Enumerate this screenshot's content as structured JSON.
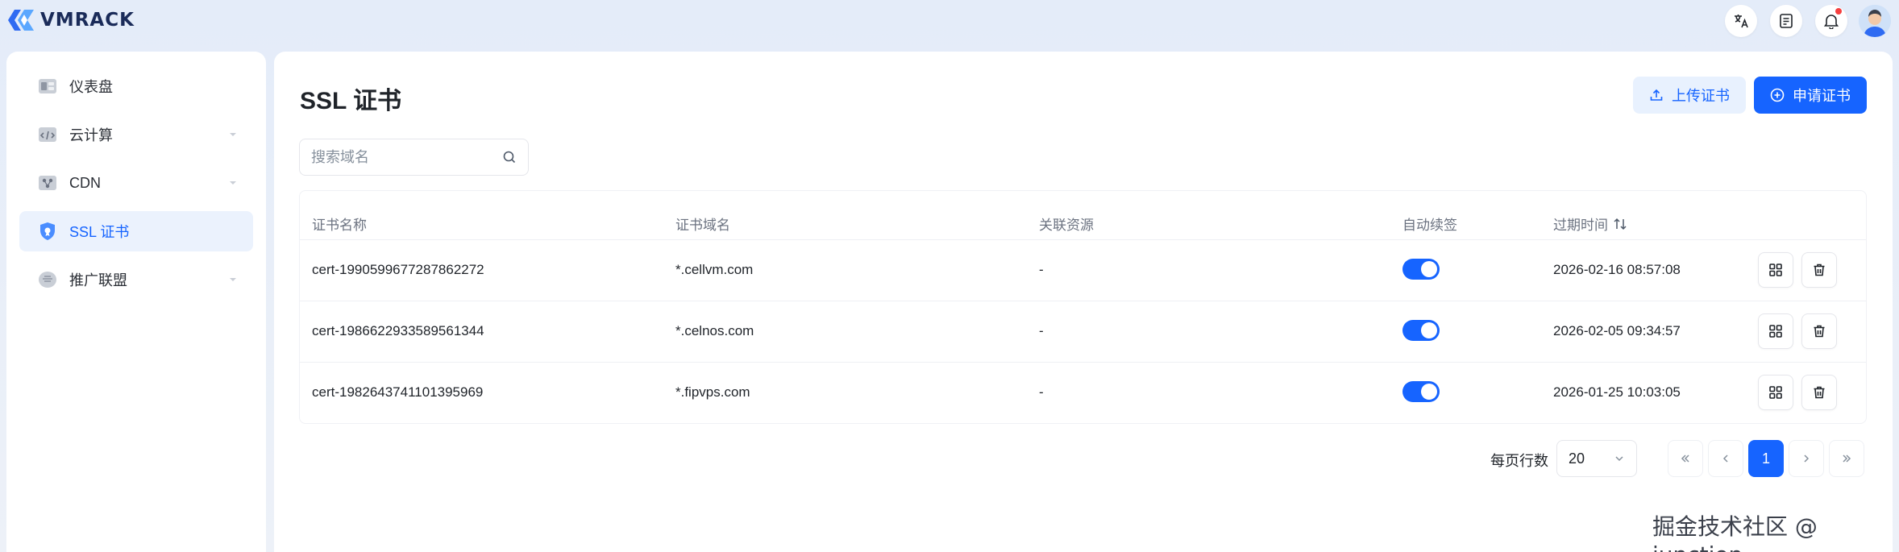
{
  "brand": {
    "name": "VMRACK"
  },
  "header": {
    "icons": [
      "translate-icon",
      "document-icon",
      "bell-icon",
      "avatar"
    ]
  },
  "sidebar": {
    "items": [
      {
        "label": "仪表盘",
        "icon": "dashboard-icon",
        "expandable": false,
        "active": false
      },
      {
        "label": "云计算",
        "icon": "cloud-compute-icon",
        "expandable": true,
        "active": false
      },
      {
        "label": "CDN",
        "icon": "cdn-icon",
        "expandable": true,
        "active": false
      },
      {
        "label": "SSL 证书",
        "icon": "shield-icon",
        "expandable": false,
        "active": true
      },
      {
        "label": "推广联盟",
        "icon": "affiliate-icon",
        "expandable": true,
        "active": false
      }
    ]
  },
  "page": {
    "title": "SSL 证书",
    "upload_label": "上传证书",
    "apply_label": "申请证书",
    "search_placeholder": "搜索域名"
  },
  "table": {
    "columns": [
      "证书名称",
      "证书域名",
      "关联资源",
      "自动续签",
      "过期时间"
    ],
    "rows": [
      {
        "name": "cert-1990599677287862272",
        "domain": "*.cellvm.com",
        "resource": "-",
        "auto_renew": true,
        "expires": "2026-02-16 08:57:08"
      },
      {
        "name": "cert-1986622933589561344",
        "domain": "*.celnos.com",
        "resource": "-",
        "auto_renew": true,
        "expires": "2026-02-05 09:34:57"
      },
      {
        "name": "cert-1982643741101395969",
        "domain": "*.fipvps.com",
        "resource": "-",
        "auto_renew": true,
        "expires": "2026-01-25 10:03:05"
      }
    ]
  },
  "pagination": {
    "rows_label": "每页行数",
    "page_size": "20",
    "current_page": "1"
  },
  "watermark": "掘金技术社区 @ junction",
  "colors": {
    "accent": "#1664ff",
    "active_bg": "#ebf2fd",
    "page_bg": "#e8eef8"
  }
}
